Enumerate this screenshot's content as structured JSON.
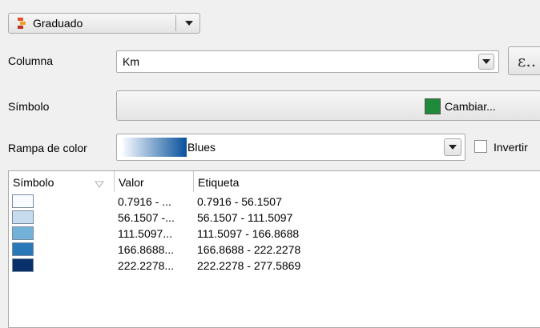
{
  "renderer": {
    "type_label": "Graduado",
    "type_icon": "graduated-renderer-icon"
  },
  "column": {
    "label": "Columna",
    "value": "Km",
    "expression_button": "ε.."
  },
  "symbol": {
    "label": "Símbolo",
    "change_button": "Cambiar...",
    "color": "#1e8a3a"
  },
  "color_ramp": {
    "label": "Rampa de color",
    "value": "Blues",
    "invert_label": "Invertir",
    "invert_checked": false,
    "gradient_start": "#f7fbff",
    "gradient_end": "#08519c"
  },
  "classes_table": {
    "headers": [
      "Símbolo",
      "Valor",
      "Etiqueta"
    ],
    "rows": [
      {
        "color": "#f7fbff",
        "value": "0.7916 - ...",
        "label": "0.7916 - 56.1507"
      },
      {
        "color": "#c8dcf0",
        "value": "56.1507 -...",
        "label": "56.1507 - 111.5097"
      },
      {
        "color": "#73b2d8",
        "value": "111.5097...",
        "label": "111.5097 - 166.8688"
      },
      {
        "color": "#2979b9",
        "value": "166.8688...",
        "label": "166.8688 - 222.2278"
      },
      {
        "color": "#08306b",
        "value": "222.2278...",
        "label": "222.2278 - 277.5869"
      }
    ]
  }
}
